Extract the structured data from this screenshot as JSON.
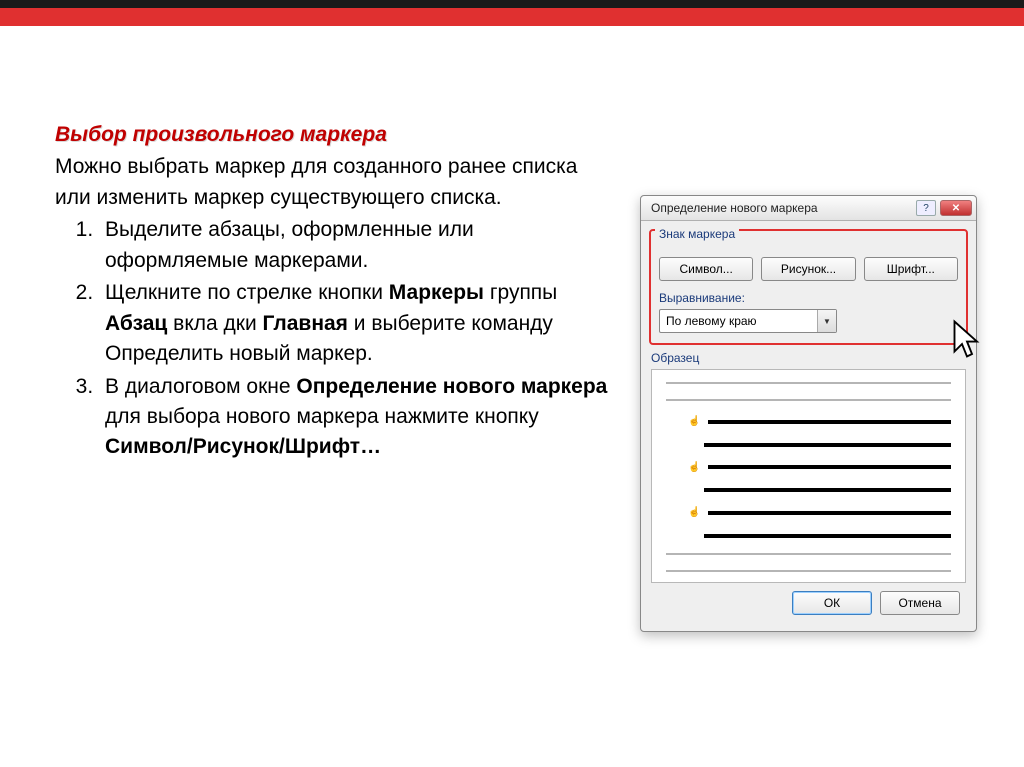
{
  "heading": "Выбор произвольного маркера",
  "intro": "Можно выбрать маркер для созданного ранее списка или изменить маркер существующего списка.",
  "steps": {
    "s1": "Выделите абзацы, оформленные или оформляемые маркерами.",
    "s2_a": "Щелкните по стрелке кнопки ",
    "s2_b": "Маркеры",
    "s2_c": " группы ",
    "s2_d": "Абзац",
    "s2_e": " вкла дки ",
    "s2_f": "Главная",
    "s2_g": " и выберите команду Определить новый маркер.",
    "s3_a": "В диалоговом окне ",
    "s3_b": "Определение нового маркера",
    "s3_c": " для выбора нового маркера нажмите кнопку ",
    "s3_d": "Символ/Рисунок/Шрифт…"
  },
  "dialog": {
    "title": "Определение нового маркера",
    "group_label": "Знак маркера",
    "btn_symbol": "Символ...",
    "btn_picture": "Рисунок...",
    "btn_font": "Шрифт...",
    "align_label": "Выравнивание:",
    "align_value": "По левому краю",
    "sample_label": "Образец",
    "ok": "ОК",
    "cancel": "Отмена",
    "help": "?",
    "close": "✕"
  }
}
